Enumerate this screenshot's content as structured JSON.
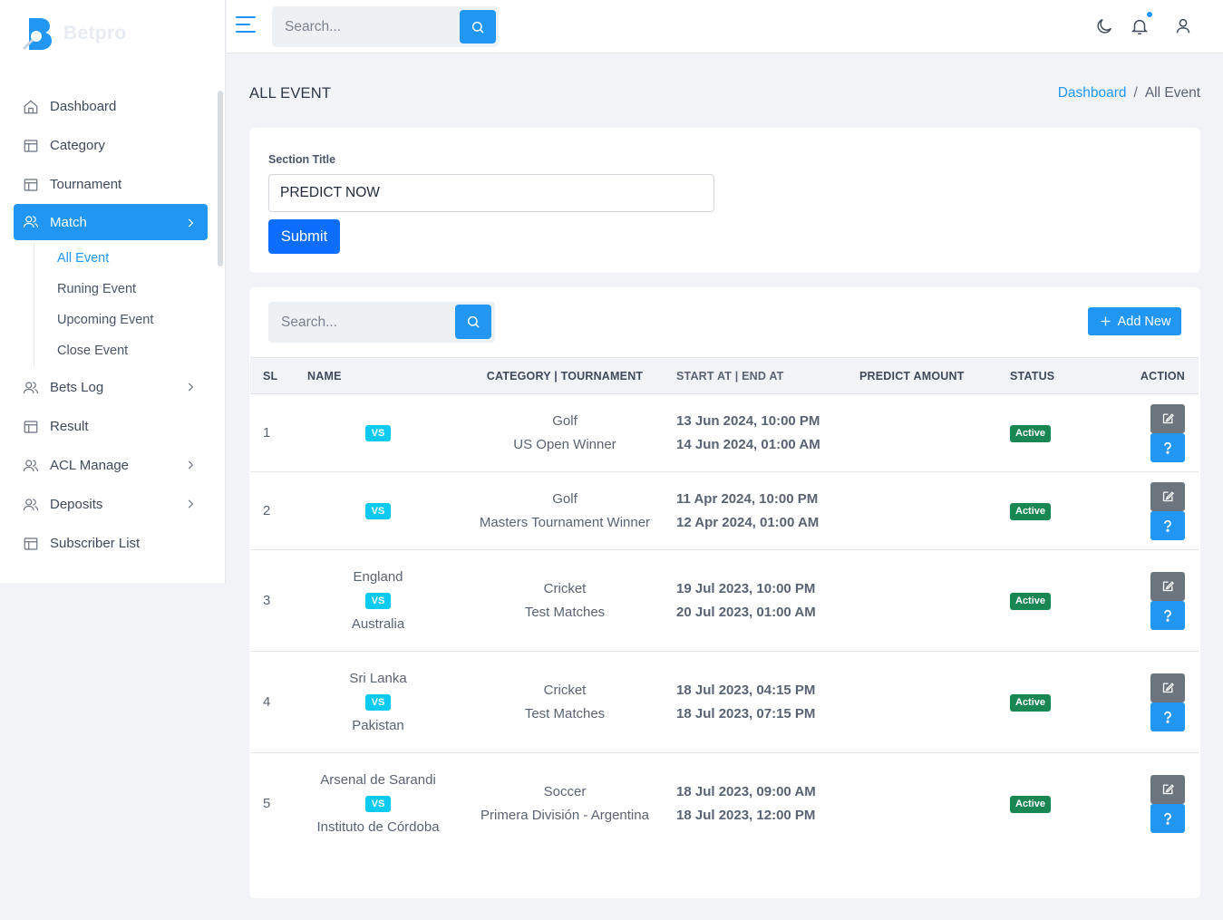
{
  "brand": {
    "name": "Betpro"
  },
  "sidebar": {
    "items": [
      {
        "label": "Dashboard",
        "icon": "home-icon"
      },
      {
        "label": "Category",
        "icon": "table-icon"
      },
      {
        "label": "Tournament",
        "icon": "table-icon"
      },
      {
        "label": "Match",
        "icon": "users-icon",
        "active": true,
        "children": [
          "All Event",
          "Runing Event",
          "Upcoming Event",
          "Close Event"
        ]
      },
      {
        "label": "Bets Log",
        "icon": "users-icon"
      },
      {
        "label": "Result",
        "icon": "table-icon"
      },
      {
        "label": "ACL Manage",
        "icon": "users-icon"
      },
      {
        "label": "Deposits",
        "icon": "users-icon"
      },
      {
        "label": "Subscriber List",
        "icon": "table-icon"
      }
    ]
  },
  "topbar": {
    "search_placeholder": "Search..."
  },
  "page": {
    "title": "ALL EVENT",
    "breadcrumb": {
      "home": "Dashboard",
      "current": "All Event"
    }
  },
  "section_form": {
    "label": "Section Title",
    "value": "PREDICT NOW",
    "submit": "Submit"
  },
  "table": {
    "search_placeholder": "Search...",
    "add_label": "Add New",
    "headers": [
      "SL",
      "NAME",
      "CATEGORY | TOURNAMENT",
      "START AT | END AT",
      "PREDICT AMOUNT",
      "STATUS",
      "ACTION"
    ],
    "vs_label": "VS",
    "rows": [
      {
        "sl": "1",
        "team1": "",
        "team2": "",
        "category": "Golf",
        "tournament": "US Open Winner",
        "start": "13 Jun 2024, 10:00 PM",
        "end": "14 Jun 2024, 01:00 AM",
        "predict": "",
        "status": "Active"
      },
      {
        "sl": "2",
        "team1": "",
        "team2": "",
        "category": "Golf",
        "tournament": "Masters Tournament Winner",
        "start": "11 Apr 2024, 10:00 PM",
        "end": "12 Apr 2024, 01:00 AM",
        "predict": "",
        "status": "Active"
      },
      {
        "sl": "3",
        "team1": "England",
        "team2": "Australia",
        "category": "Cricket",
        "tournament": "Test Matches",
        "start": "19 Jul 2023, 10:00 PM",
        "end": "20 Jul 2023, 01:00 AM",
        "predict": "",
        "status": "Active"
      },
      {
        "sl": "4",
        "team1": "Sri Lanka",
        "team2": "Pakistan",
        "category": "Cricket",
        "tournament": "Test Matches",
        "start": "18 Jul 2023, 04:15 PM",
        "end": "18 Jul 2023, 07:15 PM",
        "predict": "",
        "status": "Active"
      },
      {
        "sl": "5",
        "team1": "Arsenal de Sarandi",
        "team2": "Instituto de Córdoba",
        "category": "Soccer",
        "tournament": "Primera División - Argentina",
        "start": "18 Jul 2023, 09:00 AM",
        "end": "18 Jul 2023, 12:00 PM",
        "predict": "",
        "status": "Active"
      }
    ]
  },
  "colors": {
    "accent": "#2196f3",
    "primary_button": "#0d6efd",
    "success": "#198754",
    "vs_badge": "#0dcaf0",
    "secondary": "#6c757d"
  }
}
